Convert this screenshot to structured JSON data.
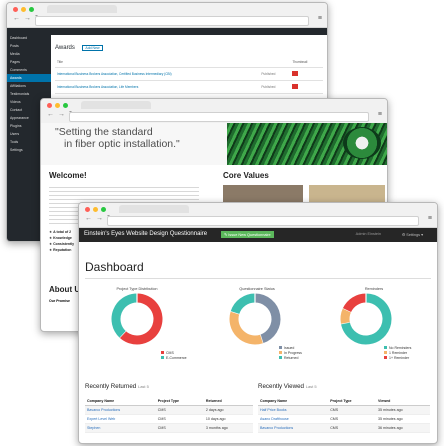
{
  "window1": {
    "page_title": "Awards",
    "add_new": "Add New",
    "table_headers": [
      "Title",
      "",
      "Thumbnail"
    ],
    "rows": [
      {
        "title": "International Business Brokers Association, Certified Business Intermediary (CBI)",
        "status": "Published"
      },
      {
        "title": "International Business Brokers Association, Life Members",
        "status": "Published"
      }
    ],
    "sidebar": [
      "Dashboard",
      "Posts",
      "Media",
      "Pages",
      "Comments",
      "Awards",
      "Affiliations",
      "Testimonials",
      "Videos",
      "Contact",
      "Appearance",
      "Plugins",
      "Users",
      "Tools",
      "Settings"
    ]
  },
  "window2": {
    "hero_quote_line1": "\"Setting the standard",
    "hero_quote_line2": "in fiber optic installation.\"",
    "welcome": "Welcome!",
    "core_values": "Core Values",
    "about": "About U",
    "bullets": [
      "A total of 2",
      "Knowledge",
      "Consistently",
      "Reputation"
    ],
    "side_labels": [
      "Our Promise"
    ]
  },
  "window3": {
    "brand": "Einstein's Eyes Website Design Questionnaire",
    "issue_button": "Issue New Questionnaire",
    "admin": "Admin Einstein",
    "settings": "Settings",
    "page_title": "Dashboard",
    "charts": [
      {
        "title": "Project Type Distribution",
        "legend": [
          "CMS",
          "E-Commerce"
        ]
      },
      {
        "title": "Questionnaire Status",
        "legend": [
          "Issued",
          "In Progress",
          "Returned"
        ]
      },
      {
        "title": "Reminders",
        "legend": [
          "No Reminders",
          "1 Reminder",
          "1+ Reminder"
        ]
      }
    ],
    "recently_returned": {
      "title": "Recently Returned",
      "count": "Last 5",
      "headers": [
        "Company Name",
        "Project Type",
        "Returned"
      ],
      "rows": [
        [
          "Bavarco Productions",
          "CMS",
          "2 days ago"
        ],
        [
          "Expert Level Web",
          "CMS",
          "10 days ago"
        ],
        [
          "Stephen",
          "CMS",
          "3 months ago"
        ]
      ]
    },
    "recently_viewed": {
      "title": "Recently Viewed",
      "count": "Last 5",
      "headers": [
        "Company Name",
        "Project Type",
        "Viewed"
      ],
      "rows": [
        [
          "Half Price Books",
          "CMS",
          "35 minutes ago"
        ],
        [
          "Asano Drafthouse",
          "CMS",
          "35 minutes ago"
        ],
        [
          "Bavarco Productions",
          "CMS",
          "36 minutes ago"
        ]
      ]
    }
  },
  "colors": {
    "cms": "#e8403e",
    "ecommerce": "#3dbfb0",
    "issued": "#7f8fa6",
    "in_progress": "#f4b46a",
    "returned": "#3dbfb0",
    "no_reminders": "#3dbfb0",
    "one_reminder": "#f4b46a",
    "more_reminders": "#e8403e"
  }
}
